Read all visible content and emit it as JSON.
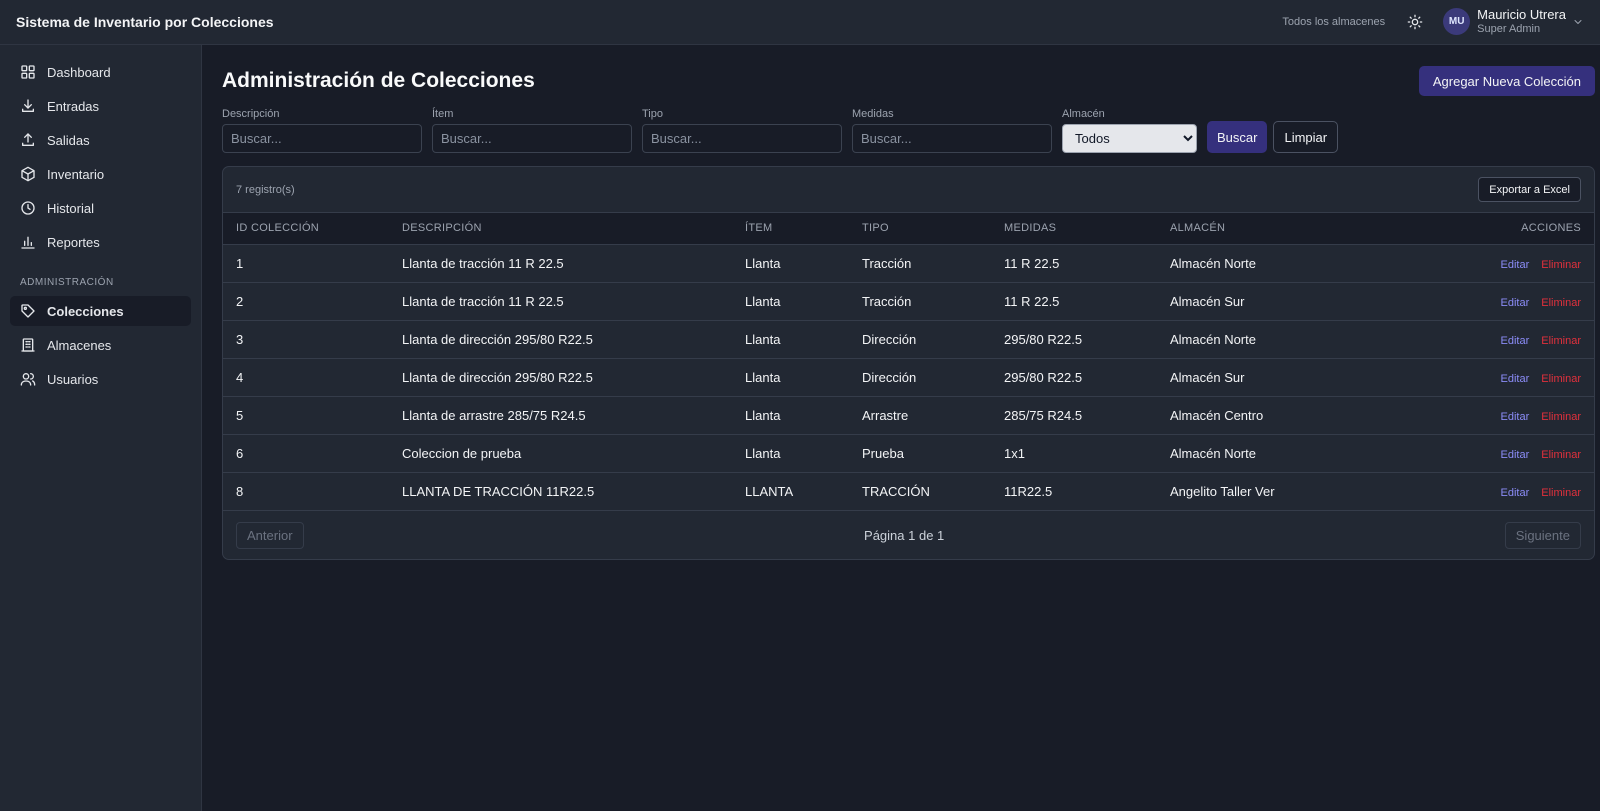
{
  "app": {
    "title": "Sistema de Inventario por Colecciones"
  },
  "header": {
    "warehouse_scope": "Todos los almacenes",
    "user": {
      "initials": "MU",
      "name": "Mauricio Utrera",
      "role": "Super Admin"
    }
  },
  "sidebar": {
    "items": [
      {
        "label": "Dashboard",
        "icon": "dashboard-icon"
      },
      {
        "label": "Entradas",
        "icon": "download-icon"
      },
      {
        "label": "Salidas",
        "icon": "upload-icon"
      },
      {
        "label": "Inventario",
        "icon": "box-icon"
      },
      {
        "label": "Historial",
        "icon": "clock-icon"
      },
      {
        "label": "Reportes",
        "icon": "bar-chart-icon"
      }
    ],
    "section_label": "ADMINISTRACIÓN",
    "admin_items": [
      {
        "label": "Colecciones",
        "icon": "tag-icon",
        "active": true
      },
      {
        "label": "Almacenes",
        "icon": "building-icon"
      },
      {
        "label": "Usuarios",
        "icon": "users-icon"
      }
    ]
  },
  "page": {
    "title": "Administración de Colecciones",
    "add_button": "Agregar Nueva Colección"
  },
  "filters": {
    "descripcion": {
      "label": "Descripción",
      "placeholder": "Buscar..."
    },
    "item": {
      "label": "Ítem",
      "placeholder": "Buscar..."
    },
    "tipo": {
      "label": "Tipo",
      "placeholder": "Buscar..."
    },
    "medidas": {
      "label": "Medidas",
      "placeholder": "Buscar..."
    },
    "almacen": {
      "label": "Almacén",
      "selected": "Todos"
    },
    "search_button": "Buscar",
    "clear_button": "Limpiar"
  },
  "table": {
    "count_text": "7 registro(s)",
    "export_button": "Exportar a Excel",
    "headers": [
      "ID COLECCIÓN",
      "DESCRIPCIÓN",
      "ÍTEM",
      "TIPO",
      "MEDIDAS",
      "ALMACÉN",
      "ACCIONES"
    ],
    "edit_label": "Editar",
    "delete_label": "Eliminar",
    "rows": [
      {
        "id": "1",
        "descripcion": "Llanta de tracción 11 R 22.5",
        "item": "Llanta",
        "tipo": "Tracción",
        "medidas": "11 R 22.5",
        "almacen": "Almacén Norte"
      },
      {
        "id": "2",
        "descripcion": "Llanta de tracción 11 R 22.5",
        "item": "Llanta",
        "tipo": "Tracción",
        "medidas": "11 R 22.5",
        "almacen": "Almacén Sur"
      },
      {
        "id": "3",
        "descripcion": "Llanta de dirección 295/80 R22.5",
        "item": "Llanta",
        "tipo": "Dirección",
        "medidas": "295/80 R22.5",
        "almacen": "Almacén Norte"
      },
      {
        "id": "4",
        "descripcion": "Llanta de dirección 295/80 R22.5",
        "item": "Llanta",
        "tipo": "Dirección",
        "medidas": "295/80 R22.5",
        "almacen": "Almacén Sur"
      },
      {
        "id": "5",
        "descripcion": "Llanta de arrastre 285/75 R24.5",
        "item": "Llanta",
        "tipo": "Arrastre",
        "medidas": "285/75 R24.5",
        "almacen": "Almacén Centro"
      },
      {
        "id": "6",
        "descripcion": "Coleccion de prueba",
        "item": "Llanta",
        "tipo": "Prueba",
        "medidas": "1x1",
        "almacen": "Almacén Norte"
      },
      {
        "id": "8",
        "descripcion": "LLANTA DE TRACCIÓN 11R22.5",
        "item": "LLANTA",
        "tipo": "TRACCIÓN",
        "medidas": "11R22.5",
        "almacen": "Angelito Taller Ver"
      }
    ]
  },
  "pagination": {
    "prev": "Anterior",
    "info": "Página 1 de 1",
    "next": "Siguiente"
  }
}
